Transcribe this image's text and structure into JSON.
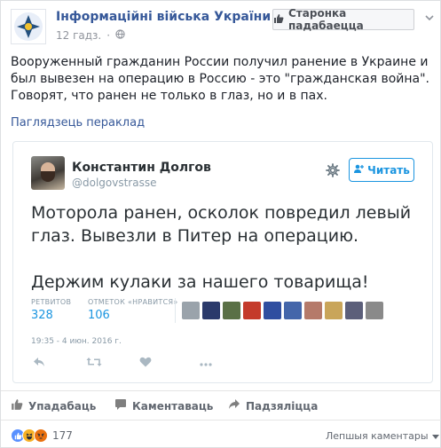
{
  "page": {
    "name": "Інформаційні війська України",
    "time": "12 гадз.",
    "privacy_icon": "globe-icon",
    "like_button": "Старонка падабаецца"
  },
  "post": {
    "text": "Вооруженный гражданин России получил ранение в Украине и был вывезен на операцию в Россию - это \"гражданская война\". Говорят, что ранен не только в глаз, но и в пах.",
    "translate_link": "Паглядзець пераклад"
  },
  "tweet": {
    "name": "Константин Долгов",
    "handle": "@dolgovstrasse",
    "follow_label": "Читать",
    "text_line1": "Моторола ранен, осколок повредил левый глаз. Вывезли в Питер на операцию.",
    "text_line2": "Держим кулаки за нашего товарища!",
    "retweets_label": "РЕТВИТОВ",
    "retweets_value": "328",
    "likes_label": "ОТМЕТОК «НРАВИТСЯ»",
    "likes_value": "106",
    "date": "19:35 - 4 июн. 2016 г.",
    "liker_colors": [
      "#9aa3ab",
      "#2b3a6b",
      "#5a7046",
      "#c43b2b",
      "#2f4ea0",
      "#4466aa",
      "#b57a6a",
      "#c9a55a",
      "#5c5f7a",
      "#8a8a8a"
    ]
  },
  "actions": {
    "like": "Упадабаць",
    "comment": "Каментаваць",
    "share": "Падзяліцца"
  },
  "reactions": {
    "count": "177",
    "sort_label": "Лепшыя каментары"
  },
  "colors": {
    "link": "#365899",
    "twitter_blue": "#1b95e0"
  }
}
